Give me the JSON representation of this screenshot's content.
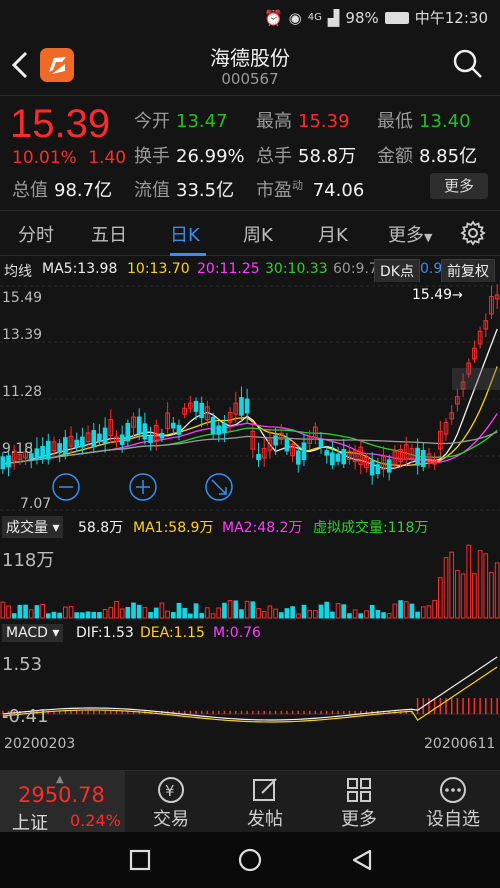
{
  "status_bar": {
    "signal": "4G",
    "battery": "98%",
    "time": "中午12:30"
  },
  "header": {
    "name": "海德股份",
    "code": "000567"
  },
  "quote": {
    "price": "15.39",
    "change_pct": "10.01%",
    "change_abs": "1.40",
    "row1": [
      {
        "label": "今开",
        "value": "13.47",
        "color": "#1ec21e"
      },
      {
        "label": "最高",
        "value": "15.39",
        "color": "#ff2b2b"
      },
      {
        "label": "最低",
        "value": "13.40",
        "color": "#1ec21e"
      }
    ],
    "row2": [
      {
        "label": "换手",
        "value": "26.99%"
      },
      {
        "label": "总手",
        "value": "58.8万"
      },
      {
        "label": "金额",
        "value": "8.85亿"
      }
    ],
    "row3": [
      {
        "label": "总值",
        "value": "98.7亿"
      },
      {
        "label": "流值",
        "value": "33.5亿"
      },
      {
        "label": "市盈",
        "sup": "动",
        "value": "74.06"
      }
    ],
    "more_label": "更多"
  },
  "tabs": [
    "分时",
    "五日",
    "日K",
    "周K",
    "月K",
    "更多"
  ],
  "active_tab": "日K",
  "ma": {
    "label": "均线",
    "ma5": "MA5:13.98",
    "ma10": "10:13.70",
    "ma20": "20:11.25",
    "ma30": "30:10.33",
    "ma60": "60:9.7",
    "dk_label": "DK点",
    "tail": "0.9",
    "fq_label": "前复权"
  },
  "kline": {
    "y_ticks": [
      "15.49",
      "13.39",
      "11.28",
      "9.18",
      "7.07"
    ],
    "high_marker": "15.49",
    "low_marker": "7.07"
  },
  "volume": {
    "selector": "成交量",
    "value": "58.8万",
    "ma1": "MA1:58.9万",
    "ma2": "MA2:48.2万",
    "virtual": "虚拟成交量:118万",
    "axis_max": "118万"
  },
  "macd": {
    "selector": "MACD",
    "dif": "DIF:1.53",
    "dea": "DEA:1.15",
    "m": "M:0.76",
    "axis_top": "1.53",
    "axis_bottom": "-0.41",
    "date_start": "20200203",
    "date_end": "20200611"
  },
  "toolbar": {
    "index_value": "2950.78",
    "index_name": "上证",
    "index_change": "0.24%",
    "items": [
      "交易",
      "发帖",
      "更多",
      "设自选"
    ]
  },
  "colors": {
    "up": "#ff2b2b",
    "down": "#1ec21e",
    "accent": "#3a8ef0",
    "cyan": "#17d4e0"
  }
}
